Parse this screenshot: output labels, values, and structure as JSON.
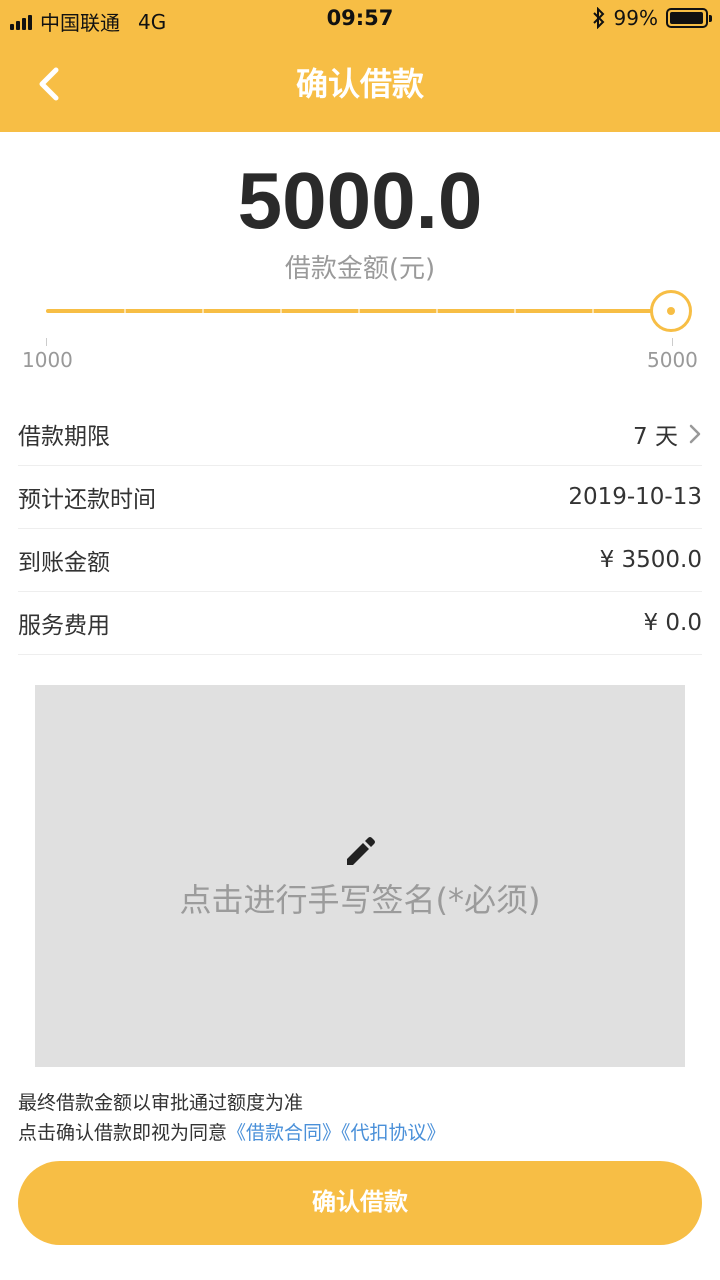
{
  "status_bar": {
    "carrier": "中国联通",
    "network": "4G",
    "time": "09:57",
    "battery": "99%",
    "bluetooth_icon": "bluetooth-icon"
  },
  "nav": {
    "title": "确认借款",
    "back_icon": "chevron-left-icon"
  },
  "loan": {
    "amount": "5000.0",
    "amount_label": "借款金额(元)",
    "slider": {
      "min_label": "1000",
      "max_label": "5000",
      "value": 5000,
      "min": 1000,
      "max": 5000
    }
  },
  "details": [
    {
      "label": "借款期限",
      "value": "7 天",
      "has_chevron": true
    },
    {
      "label": "预计还款时间",
      "value": "2019-10-13"
    },
    {
      "label": "到账金额",
      "value": "¥ 3500.0"
    },
    {
      "label": "服务费用",
      "value": "¥ 0.0"
    }
  ],
  "signature": {
    "icon": "pencil-icon",
    "prompt": "点击进行手写签名(*必须)"
  },
  "notes": {
    "line1": "最终借款金额以审批通过额度为准",
    "line2_prefix": "点击确认借款即视为同意",
    "link_contract": "《借款合同》",
    "link_agreement": "《代扣协议》"
  },
  "confirm_button": "确认借款",
  "colors": {
    "accent": "#F7BE45",
    "link": "#4a90d9"
  }
}
